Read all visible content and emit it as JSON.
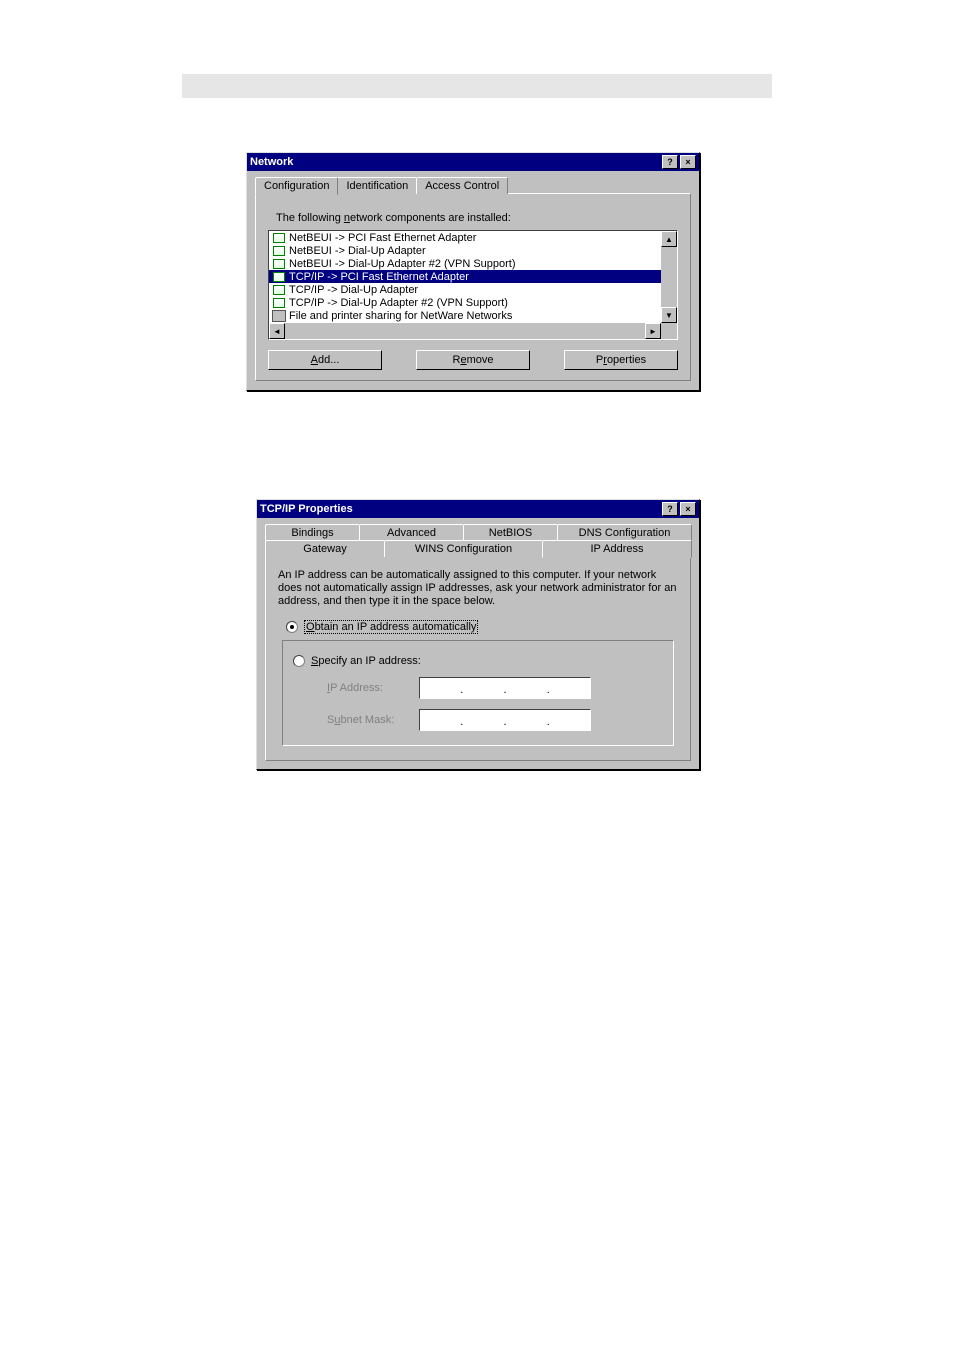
{
  "dialog1": {
    "title": "Network",
    "tabs": [
      "Configuration",
      "Identification",
      "Access Control"
    ],
    "active_tab": 0,
    "instruction": "The following network components are installed:",
    "items": [
      {
        "text": "NetBEUI -> PCI Fast Ethernet Adapter",
        "icon": "protocol",
        "selected": false
      },
      {
        "text": "NetBEUI -> Dial-Up Adapter",
        "icon": "protocol",
        "selected": false
      },
      {
        "text": "NetBEUI -> Dial-Up Adapter #2 (VPN Support)",
        "icon": "protocol",
        "selected": false
      },
      {
        "text": "TCP/IP -> PCI Fast Ethernet Adapter",
        "icon": "protocol",
        "selected": true
      },
      {
        "text": "TCP/IP -> Dial-Up Adapter",
        "icon": "protocol",
        "selected": false
      },
      {
        "text": "TCP/IP -> Dial-Up Adapter #2 (VPN Support)",
        "icon": "protocol",
        "selected": false
      },
      {
        "text": "File and printer sharing for NetWare Networks",
        "icon": "service",
        "selected": false
      }
    ],
    "buttons": {
      "add": "Add...",
      "remove": "Remove",
      "properties": "Properties"
    }
  },
  "dialog2": {
    "title": "TCP/IP Properties",
    "tabs_row1": [
      "Bindings",
      "Advanced",
      "NetBIOS",
      "DNS Configuration"
    ],
    "tabs_row2": [
      "Gateway",
      "WINS Configuration",
      "IP Address"
    ],
    "active_tab_row2": 2,
    "helptext": "An IP address can be automatically assigned to this computer.  If your network does not automatically assign IP addresses, ask your network administrator for an address, and then type it in the space below.",
    "radio_obtain": "Obtain an IP address automatically",
    "radio_specify": "Specify an IP address:",
    "radio_selected": "obtain",
    "ip_label": "IP Address:",
    "subnet_label": "Subnet Mask:"
  }
}
